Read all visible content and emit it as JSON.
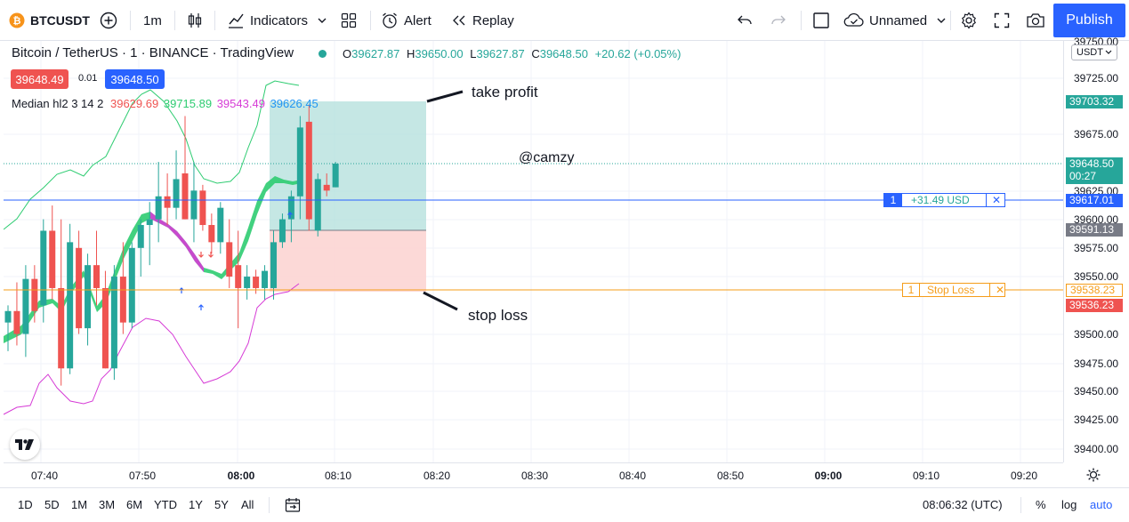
{
  "topbar": {
    "symbol": "BTCUSDT",
    "interval": "1m",
    "indicators_label": "Indicators",
    "alert_label": "Alert",
    "replay_label": "Replay",
    "layout_name": "Unnamed",
    "publish_label": "Publish"
  },
  "legend": {
    "title": "Bitcoin / TetherUS · 1 · BINANCE · TradingView",
    "ohlc": {
      "o_label": "O",
      "o": "39627.87",
      "h_label": "H",
      "h": "39650.00",
      "l_label": "L",
      "l": "39627.87",
      "c_label": "C",
      "c": "39648.50",
      "change": "+20.62 (+0.05%)"
    },
    "sell_price": "39648.49",
    "spread": "0.01",
    "buy_price": "39648.50",
    "indicator_name": "Median hl2 3 14 2",
    "indicator_values": [
      "39629.69",
      "39715.89",
      "39543.49",
      "39626.45"
    ]
  },
  "annotations": {
    "take_profit": "take profit",
    "stop_loss": "stop loss",
    "author": "@camzy"
  },
  "position": {
    "qty": "1",
    "pnl": "+31.49 USD",
    "sl_qty": "1",
    "sl_label": "Stop Loss",
    "close_symbol": "✕"
  },
  "price_axis": {
    "currency": "USDT",
    "ticks": [
      "39725.00",
      "39675.00",
      "39625.00",
      "39600.00",
      "39575.00",
      "39550.00",
      "39500.00",
      "39475.00",
      "39450.00",
      "39425.00",
      "39400.00"
    ],
    "top_partial": "39750.00",
    "labels": {
      "take_profit": "39703.32",
      "last": "39648.50",
      "countdown": "00:27",
      "entry": "39617.01",
      "median": "39591.13",
      "stop_order": "39538.23",
      "stop_loss": "39536.23"
    }
  },
  "time_axis": {
    "ticks": [
      "07:40",
      "07:50",
      "08:00",
      "08:10",
      "08:20",
      "08:30",
      "08:40",
      "08:50",
      "09:00",
      "09:10",
      "09:20"
    ]
  },
  "bottombar": {
    "ranges": [
      "1D",
      "5D",
      "1M",
      "3M",
      "6M",
      "YTD",
      "1Y",
      "5Y",
      "All"
    ],
    "clock": "08:06:32 (UTC)",
    "percent": "%",
    "log": "log",
    "auto": "auto"
  },
  "colors": {
    "up": "#26a69a",
    "down": "#ef5350",
    "accent": "#2962ff",
    "target_zone": "#b2dfdb",
    "stop_zone": "#fcd5d3",
    "band_upper": "#2ecc71",
    "band_lower": "#d63bd6",
    "entry_line": "#2962ff",
    "stop_line": "#f59d1a"
  }
}
